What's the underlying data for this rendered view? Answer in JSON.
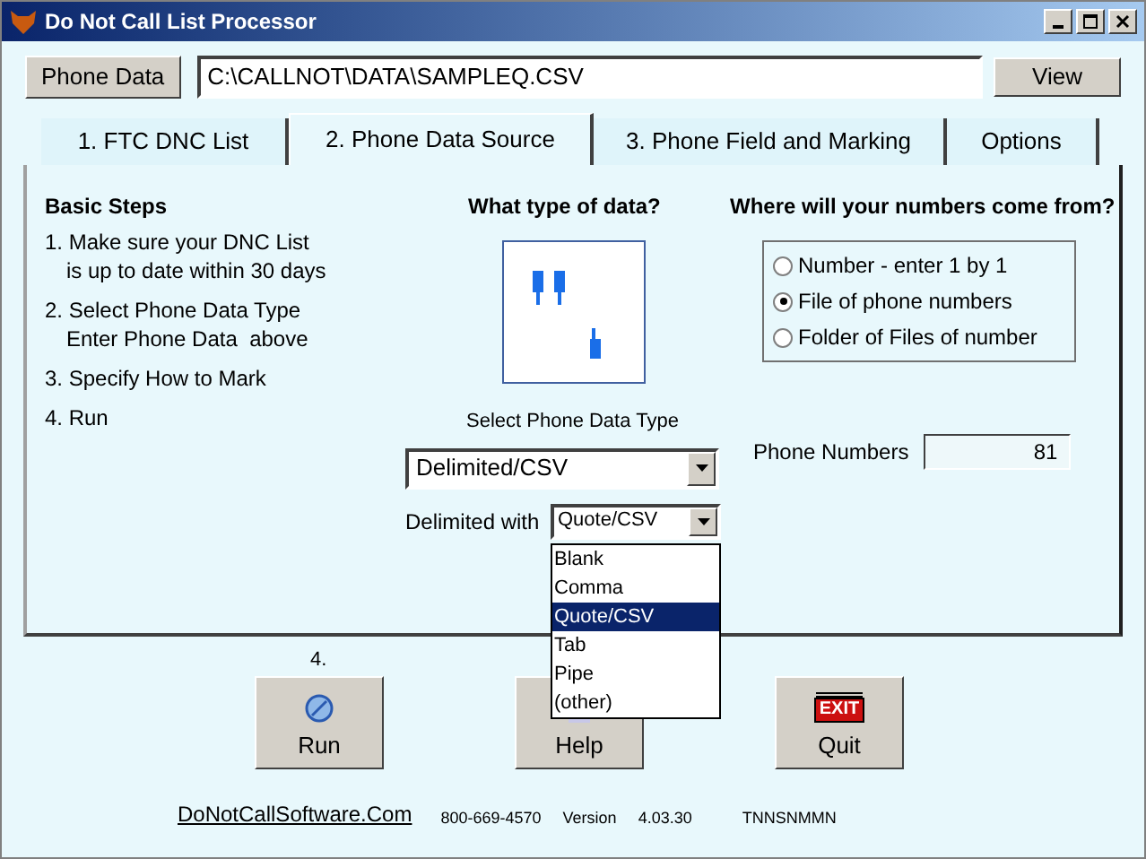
{
  "window": {
    "title": "Do Not Call List Processor"
  },
  "file_bar": {
    "button": "Phone Data",
    "path": "C:\\CALLNOT\\DATA\\SAMPLEQ.CSV",
    "view_button": "View"
  },
  "tabs": [
    {
      "label": "1. FTC DNC List",
      "selected": false
    },
    {
      "label": "2. Phone Data Source",
      "selected": true
    },
    {
      "label": "3. Phone Field and Marking",
      "selected": false
    },
    {
      "label": "Options",
      "selected": false
    }
  ],
  "basic_steps": {
    "title": "Basic Steps",
    "steps": [
      [
        "1. Make sure your DNC List",
        "is up to date within 30 days"
      ],
      [
        "2. Select Phone Data Type",
        "Enter Phone Data  above"
      ],
      [
        "3. Specify How to Mark"
      ],
      [
        "4. Run"
      ]
    ]
  },
  "data_type": {
    "heading": "What type of data?",
    "select_label": "Select Phone Data Type",
    "select_value": "Delimited/CSV",
    "delimiter_label": "Delimited with",
    "delimiter_value": "Quote/CSV",
    "delimiter_options": [
      {
        "label": "Blank",
        "selected": false
      },
      {
        "label": "Comma",
        "selected": false
      },
      {
        "label": "Quote/CSV",
        "selected": true
      },
      {
        "label": "Tab",
        "selected": false
      },
      {
        "label": "Pipe",
        "selected": false
      },
      {
        "label": "(other)",
        "selected": false
      }
    ]
  },
  "source": {
    "heading": "Where will your numbers come from?",
    "options": [
      {
        "label": "Number - enter 1 by 1",
        "selected": false
      },
      {
        "label": "File of phone numbers",
        "selected": true
      },
      {
        "label": "Folder of Files of number",
        "selected": false
      }
    ],
    "count_label": "Phone Numbers",
    "count_value": "81"
  },
  "actions": {
    "step_label": "4.",
    "exit_sign": "EXIT",
    "buttons": [
      {
        "kind": "run",
        "label": "Run"
      },
      {
        "kind": "help",
        "label": "Help"
      },
      {
        "kind": "quit",
        "label": "Quit"
      }
    ]
  },
  "footer": {
    "link": "DoNotCallSoftware.Com",
    "phone": "800-669-4570",
    "version_label": "Version",
    "version": "4.03.30",
    "code": "TNNSNMMN"
  }
}
